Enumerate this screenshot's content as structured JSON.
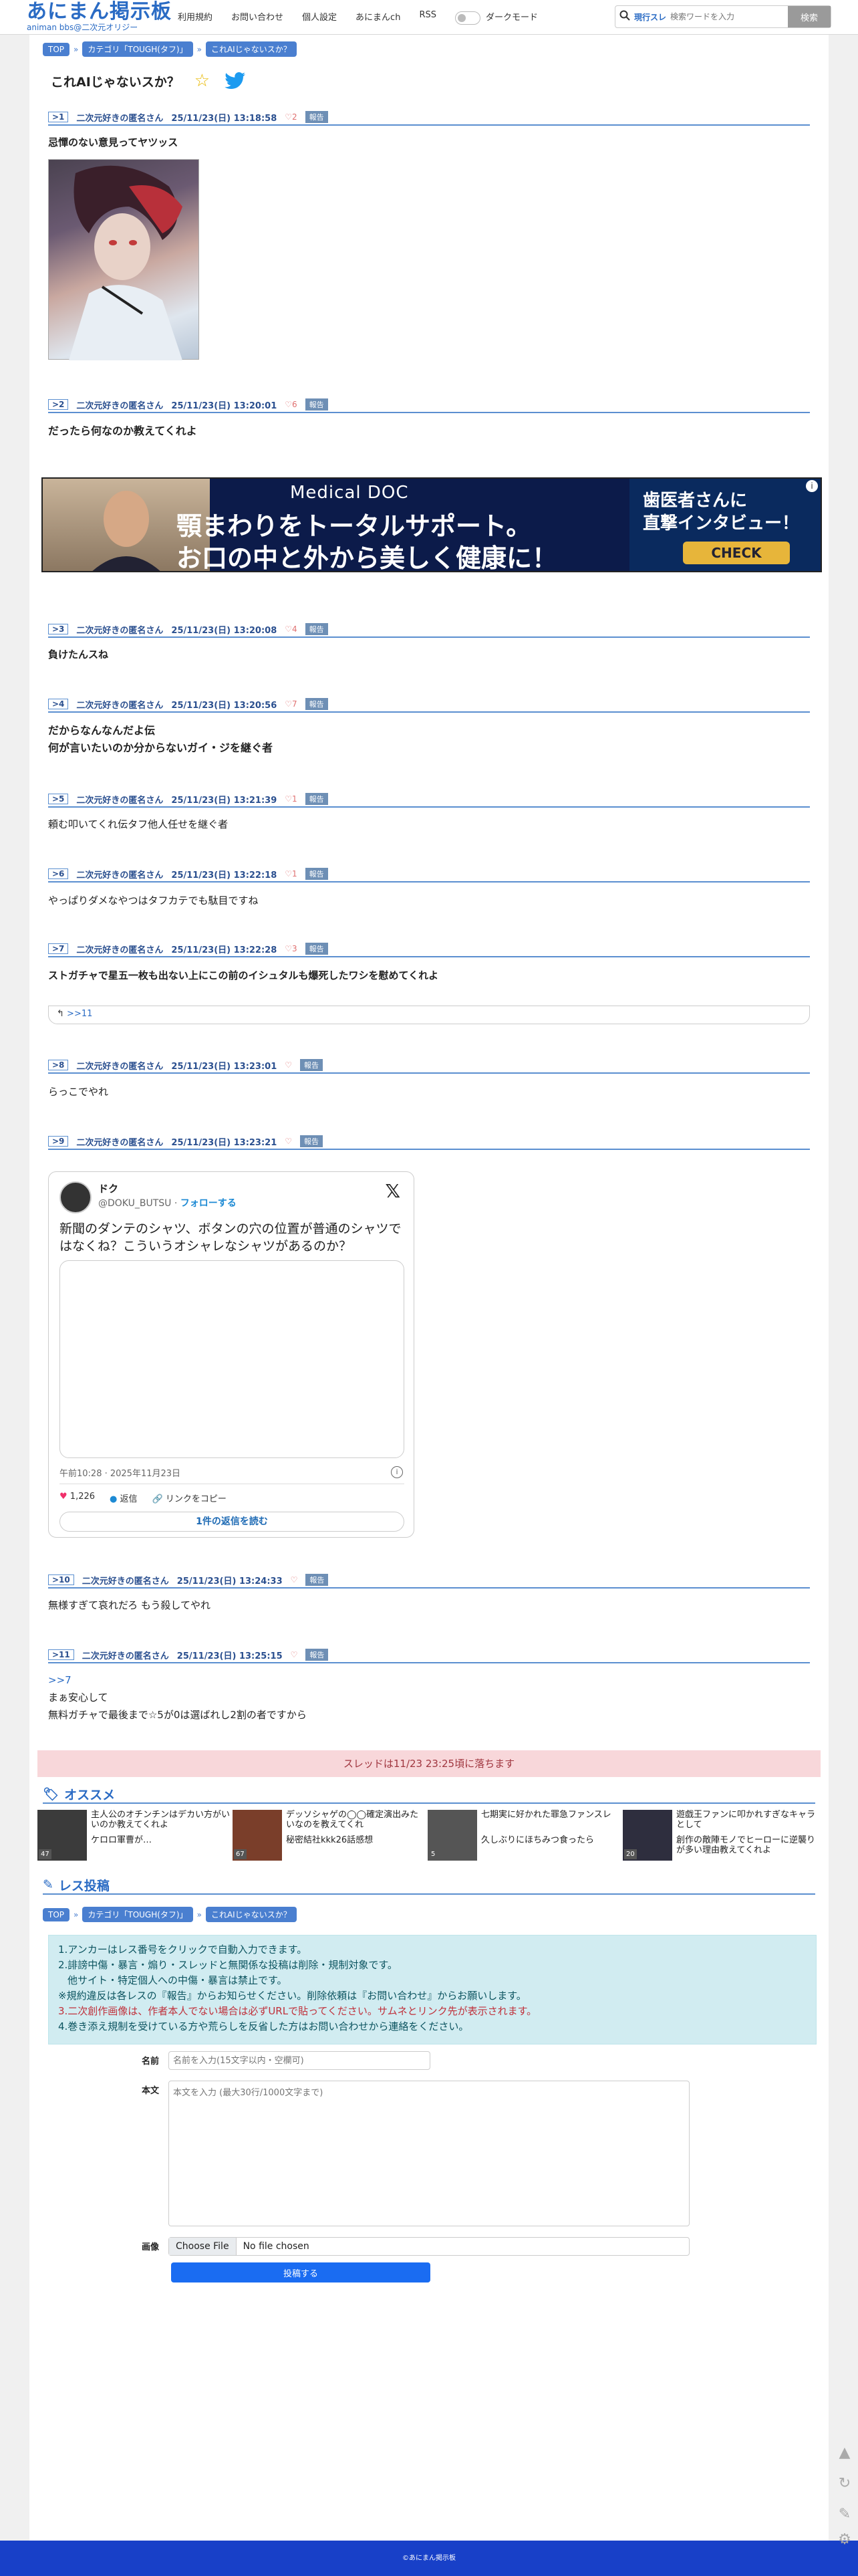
{
  "header": {
    "logo_main": "あにまん掲示板",
    "logo_sub": "animan bbs@二次元オリジー",
    "nav": [
      "利用規約",
      "お問い合わせ",
      "個人設定",
      "あにまんch",
      "RSS"
    ],
    "dark_mode_label": "ダークモード",
    "search_scope": "現行スレ",
    "search_placeholder": "検索ワードを入力",
    "search_button": "検索"
  },
  "breadcrumbs": [
    "TOP",
    "カテゴリ「TOUGH(タフ)」",
    "これAIじゃないスか？"
  ],
  "thread_title": "これAIじゃないスか？",
  "posts": [
    {
      "num": ">1",
      "name": "二次元好きの匿名さん",
      "date": "25/11/23(日) 13:18:58",
      "likes": "2",
      "report": "報告",
      "lines": [
        "忌憚のない意見ってヤツッス"
      ]
    },
    {
      "num": ">2",
      "name": "二次元好きの匿名さん",
      "date": "25/11/23(日) 13:20:01",
      "likes": "6",
      "report": "報告",
      "lines": [
        "だったら何なのか教えてくれよ"
      ]
    },
    {
      "num": ">3",
      "name": "二次元好きの匿名さん",
      "date": "25/11/23(日) 13:20:08",
      "likes": "4",
      "report": "報告",
      "lines": [
        "負けたんスね"
      ]
    },
    {
      "num": ">4",
      "name": "二次元好きの匿名さん",
      "date": "25/11/23(日) 13:20:56",
      "likes": "7",
      "report": "報告",
      "lines": [
        "だからなんなんだよ伝",
        "何が言いたいのか分からないガイ・ジを継ぐ者"
      ]
    },
    {
      "num": ">5",
      "name": "二次元好きの匿名さん",
      "date": "25/11/23(日) 13:21:39",
      "likes": "1",
      "report": "報告",
      "lines": [
        "頼む叩いてくれ伝タフ他人任せを継ぐ者"
      ]
    },
    {
      "num": ">6",
      "name": "二次元好きの匿名さん",
      "date": "25/11/23(日) 13:22:18",
      "likes": "1",
      "report": "報告",
      "lines": [
        "やっぱりダメなやつはタフカテでも駄目ですね"
      ]
    },
    {
      "num": ">7",
      "name": "二次元好きの匿名さん",
      "date": "25/11/23(日) 13:22:28",
      "likes": "3",
      "report": "報告",
      "lines": [
        "ストガチャで星五一枚も出ない上にこの前のイシュタルも爆死したワシを慰めてくれよ"
      ],
      "reply": ">>11"
    },
    {
      "num": ">8",
      "name": "二次元好きの匿名さん",
      "date": "25/11/23(日) 13:23:01",
      "likes": "",
      "report": "報告",
      "lines": [
        "らっこでやれ"
      ]
    },
    {
      "num": ">9",
      "name": "二次元好きの匿名さん",
      "date": "25/11/23(日) 13:23:21",
      "likes": "",
      "report": "報告",
      "lines": []
    },
    {
      "num": ">10",
      "name": "二次元好きの匿名さん",
      "date": "25/11/23(日) 13:24:33",
      "likes": "",
      "report": "報告",
      "lines": [
        "無様すぎて哀れだろ もう殺してやれ"
      ]
    },
    {
      "num": ">11",
      "name": "二次元好きの匿名さん",
      "date": "25/11/23(日) 13:25:15",
      "likes": "",
      "report": "報告",
      "anchor": ">>7",
      "lines": [
        "まぁ安心して",
        "無料ガチャで最後まで☆5が0は選ばれし2割の者ですから"
      ]
    }
  ],
  "ad": {
    "brand": "Medical DOC",
    "line1": "顎まわりをトータルサポート。",
    "line2": "お口の中と外から美しく健康に！",
    "side1": "歯医者さんに",
    "side2": "直撃インタビュー！",
    "cta": "CHECK"
  },
  "tweet": {
    "name": "ドク",
    "handle": "@DOKU_BUTSU",
    "follow": "フォローする",
    "text": "新聞のダンテのシャツ、ボタンの穴の位置が普通のシャツではなくね？こういうオシャレなシャツがあるのか？",
    "time": "午前10:28 · 2025年11月23日",
    "likes": "1,226",
    "reply": "返信",
    "copy": "リンクをコピー",
    "read_replies": "1件の返信を読む"
  },
  "notice": "スレッドは11/23 23:25頃に落ちます",
  "recommend": {
    "title": "オススメ",
    "items": [
      {
        "t1": "主人公のオチンチンはデカい方がいいのか教えてくれよ",
        "t2": "ケロロ軍曹が…",
        "count": "47"
      },
      {
        "t1": "デッソシャゲの◯◯確定演出みたいなのを教えてくれ",
        "t2": "秘密結社kkk26話感想",
        "count": "67"
      },
      {
        "t1": "七期実に好かれた罪急ファンスレ",
        "t2": "久しぶりにほちみつ食ったら",
        "count": "5"
      },
      {
        "t1": "遊戯王ファンに叩かれすぎなキャラとして",
        "t2": "創作の敵陣モノでヒーローに逆襲りが多い理由教えてくれよ",
        "count": "20"
      }
    ]
  },
  "post_form": {
    "title": "レス投稿",
    "rules": [
      "1.アンカーはレス番号をクリックで自動入力できます。",
      "2.誹謗中傷・暴言・煽り・スレッドと無関係な投稿は削除・規制対象です。",
      "  他サイト・特定個人への中傷・暴言は禁止です。",
      "※規約違反は各レスの『報告』からお知らせください。削除依頼は『お問い合わせ』からお願いします。",
      "3.二次創作画像は、作者本人でない場合は必ずURLで貼ってください。サムネとリンク先が表示されます。",
      "4.巻き添え規制を受けている方や荒らしを反省した方はお問い合わせから連絡をください。"
    ],
    "name_label": "名前",
    "name_placeholder": "名前を入力(15文字以内・空欄可)",
    "body_label": "本文",
    "body_placeholder": "本文を入力 (最大30行/1000文字まで)",
    "image_label": "画像",
    "file_button": "Choose File",
    "file_status": "No file chosen",
    "submit": "投稿する"
  },
  "footer": "©あにまん掲示板",
  "colors": {
    "accent": "#2a6bc4",
    "header_line": "#5b8fd0",
    "footer": "#1840c8",
    "notice_bg": "#f8d7da"
  }
}
